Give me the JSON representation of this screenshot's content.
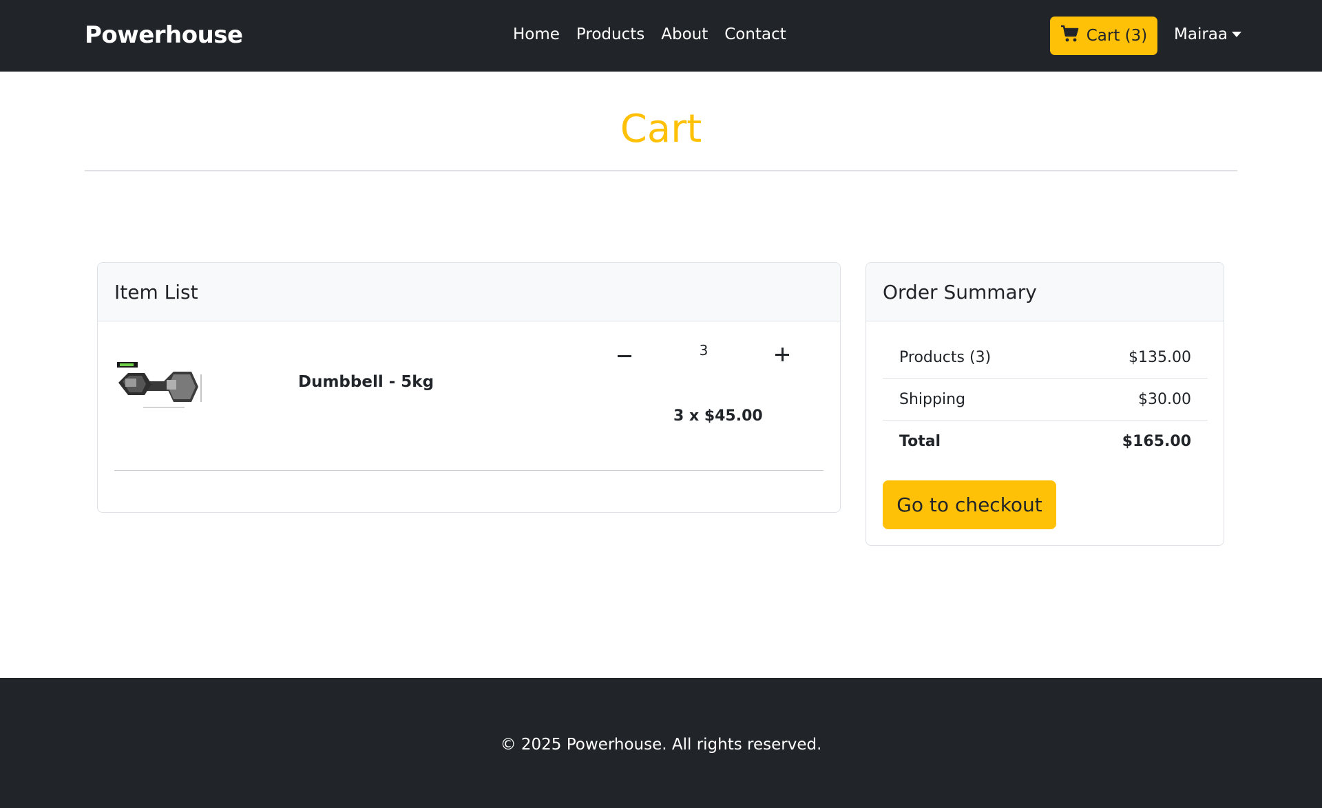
{
  "navbar": {
    "brand": "Powerhouse",
    "links": [
      "Home",
      "Products",
      "About",
      "Contact"
    ],
    "cart_label": "Cart (3)",
    "cart_icon": "shopping-cart-icon",
    "user_name": "Mairaa",
    "background_color": "#212529",
    "accent_color": "#ffc107"
  },
  "page": {
    "title": "Cart"
  },
  "item_list": {
    "heading": "Item List",
    "items": [
      {
        "name": "Dumbbell - 5kg",
        "quantity": "3",
        "line_price": "3 x $45.00",
        "image": "dumbbell-product-image"
      }
    ]
  },
  "order_summary": {
    "heading": "Order Summary",
    "rows": [
      {
        "label": "Products (3)",
        "value": "$135.00"
      },
      {
        "label": "Shipping",
        "value": "$30.00"
      },
      {
        "label": "Total",
        "value": "$165.00"
      }
    ],
    "checkout_label": "Go to checkout"
  },
  "footer": {
    "text": "© 2025 Powerhouse. All rights reserved."
  }
}
